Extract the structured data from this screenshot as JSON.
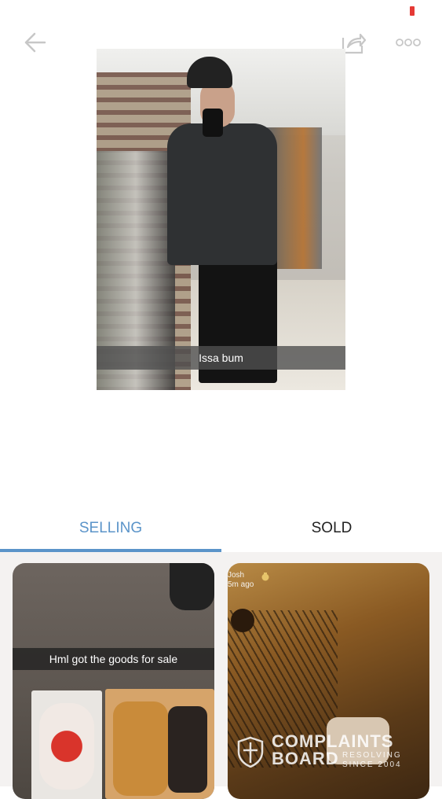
{
  "header": {
    "back_icon": "arrow-left-icon",
    "share_icon": "share-icon",
    "more_icon": "more-horizontal-icon",
    "status_color": "#e53935"
  },
  "photo": {
    "caption": "Issa bum"
  },
  "tabs": [
    {
      "label": "SELLING",
      "selected": true
    },
    {
      "label": "SOLD",
      "selected": false
    }
  ],
  "accent_color": "#5b94c9",
  "listings": [
    {
      "caption": "Hml got the goods for sale"
    },
    {
      "user_name": "Josh",
      "time_ago": "5m ago"
    }
  ],
  "watermark": {
    "title": "COMPLAINTS",
    "subtitle": "BOARD",
    "tagline_1": "RESOLVING",
    "tagline_2": "SINCE 2004"
  }
}
